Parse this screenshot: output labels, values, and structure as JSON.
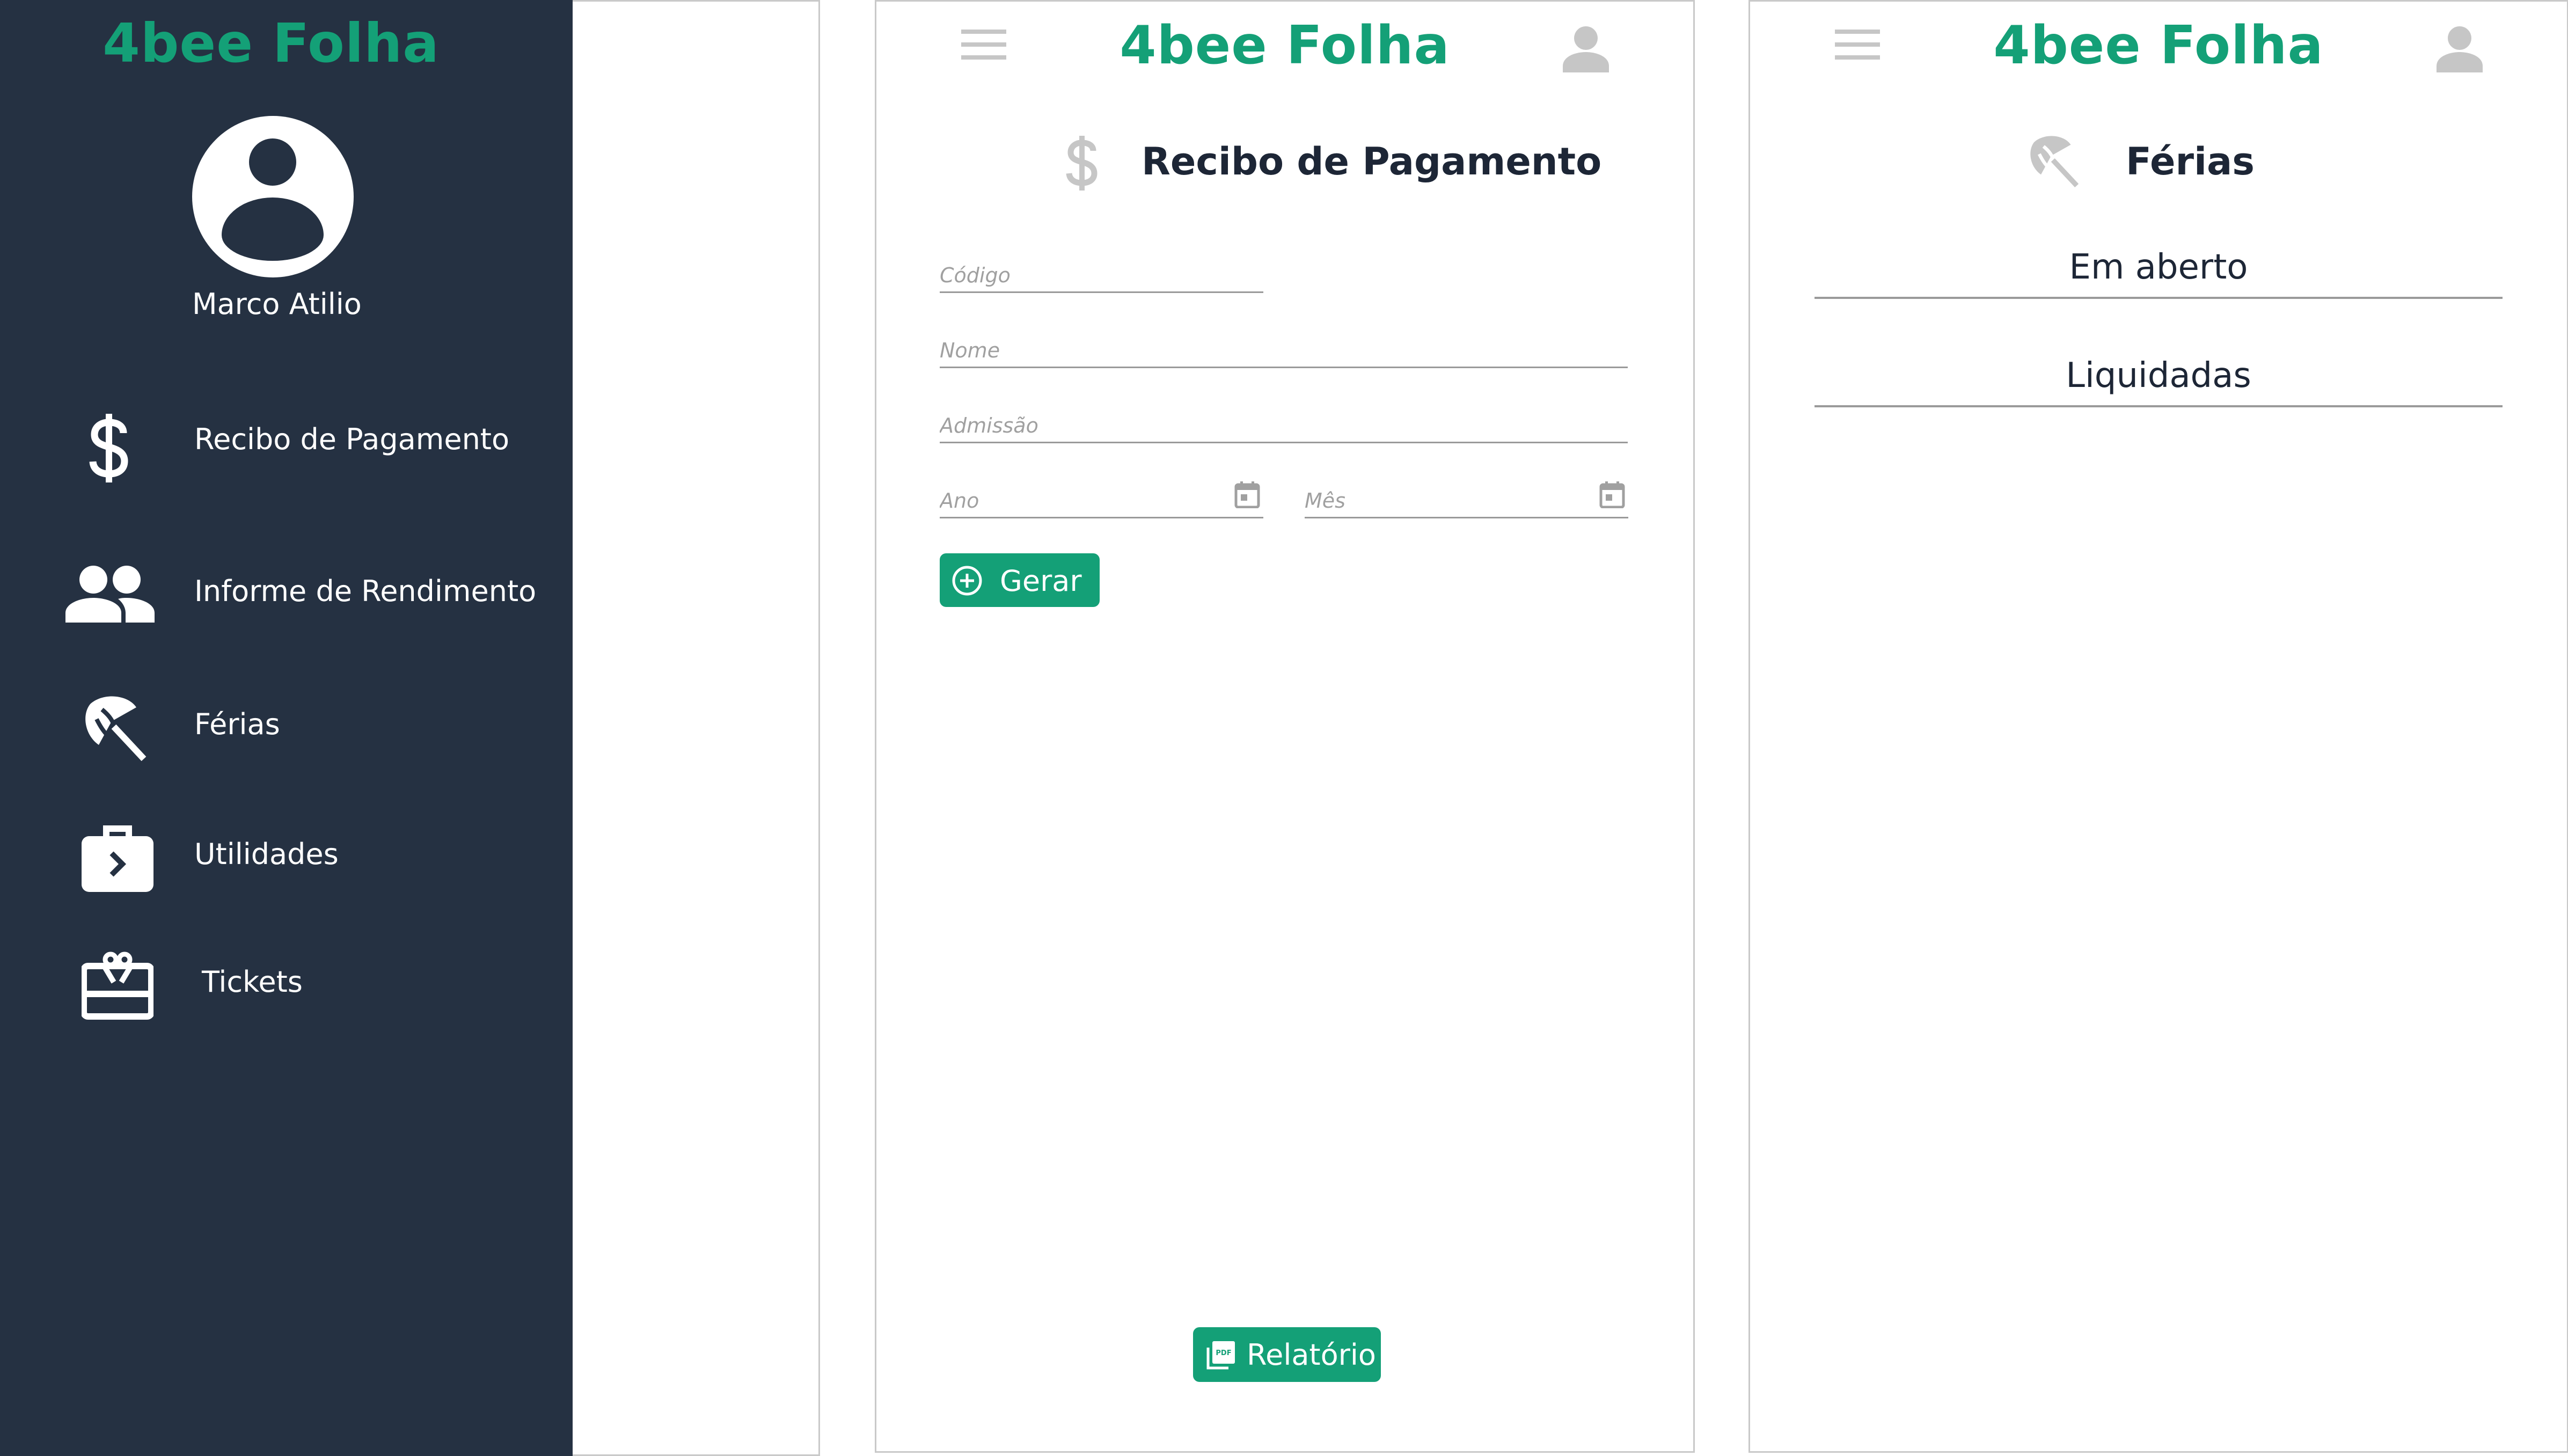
{
  "app": {
    "title": "4bee Folha"
  },
  "drawer": {
    "user_name": "Marco Atilio",
    "items": [
      {
        "label": "Recibo de Pagamento",
        "icon": "dollar-icon"
      },
      {
        "label": "Informe de Rendimento",
        "icon": "people-icon"
      },
      {
        "label": "Férias",
        "icon": "beach-umbrella-icon"
      },
      {
        "label": "Utilidades",
        "icon": "briefcase-arrow-icon"
      },
      {
        "label": "Tickets",
        "icon": "ticket-icon"
      }
    ]
  },
  "recibo": {
    "title": "Recibo de Pagamento",
    "fields": {
      "codigo": {
        "placeholder": "Código",
        "value": ""
      },
      "nome": {
        "placeholder": "Nome",
        "value": ""
      },
      "admissao": {
        "placeholder": "Admissão",
        "value": ""
      },
      "ano": {
        "placeholder": "Ano",
        "value": ""
      },
      "mes": {
        "placeholder": "Mês",
        "value": ""
      }
    },
    "gerar_label": "Gerar",
    "relatorio_label": "Relatório"
  },
  "ferias": {
    "title": "Férias",
    "options": [
      "Em aberto",
      "Liquidadas"
    ]
  },
  "colors": {
    "brand_green": "#14a077",
    "drawer_bg": "#253142",
    "icon_gray": "#c6c6c6",
    "text_dark": "#1d2636"
  }
}
